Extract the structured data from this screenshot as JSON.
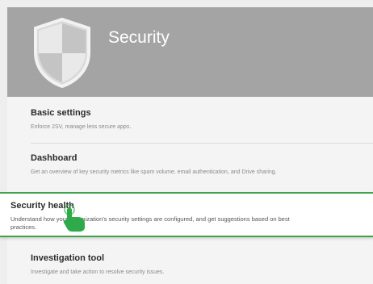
{
  "header": {
    "title": "Security",
    "icon": "shield-icon",
    "background": "#a4a4a4"
  },
  "items": [
    {
      "title": "Basic settings",
      "description": "Enforce 2SV, manage less secure apps."
    },
    {
      "title": "Dashboard",
      "description": "Get an overview of key security metrics like spam volume, email authentication, and Drive sharing."
    },
    {
      "title": "Security health",
      "description": "Understand how your organization's security settings are configured, and get suggestions based on best practices.",
      "highlighted": true
    },
    {
      "title": "Investigation tool",
      "description": "Investigate and take action to resolve security issues."
    }
  ],
  "colors": {
    "highlight_border": "#3fa34d",
    "hand": "#2eaa4a"
  },
  "cursor_icon": "pointing-hand-icon"
}
